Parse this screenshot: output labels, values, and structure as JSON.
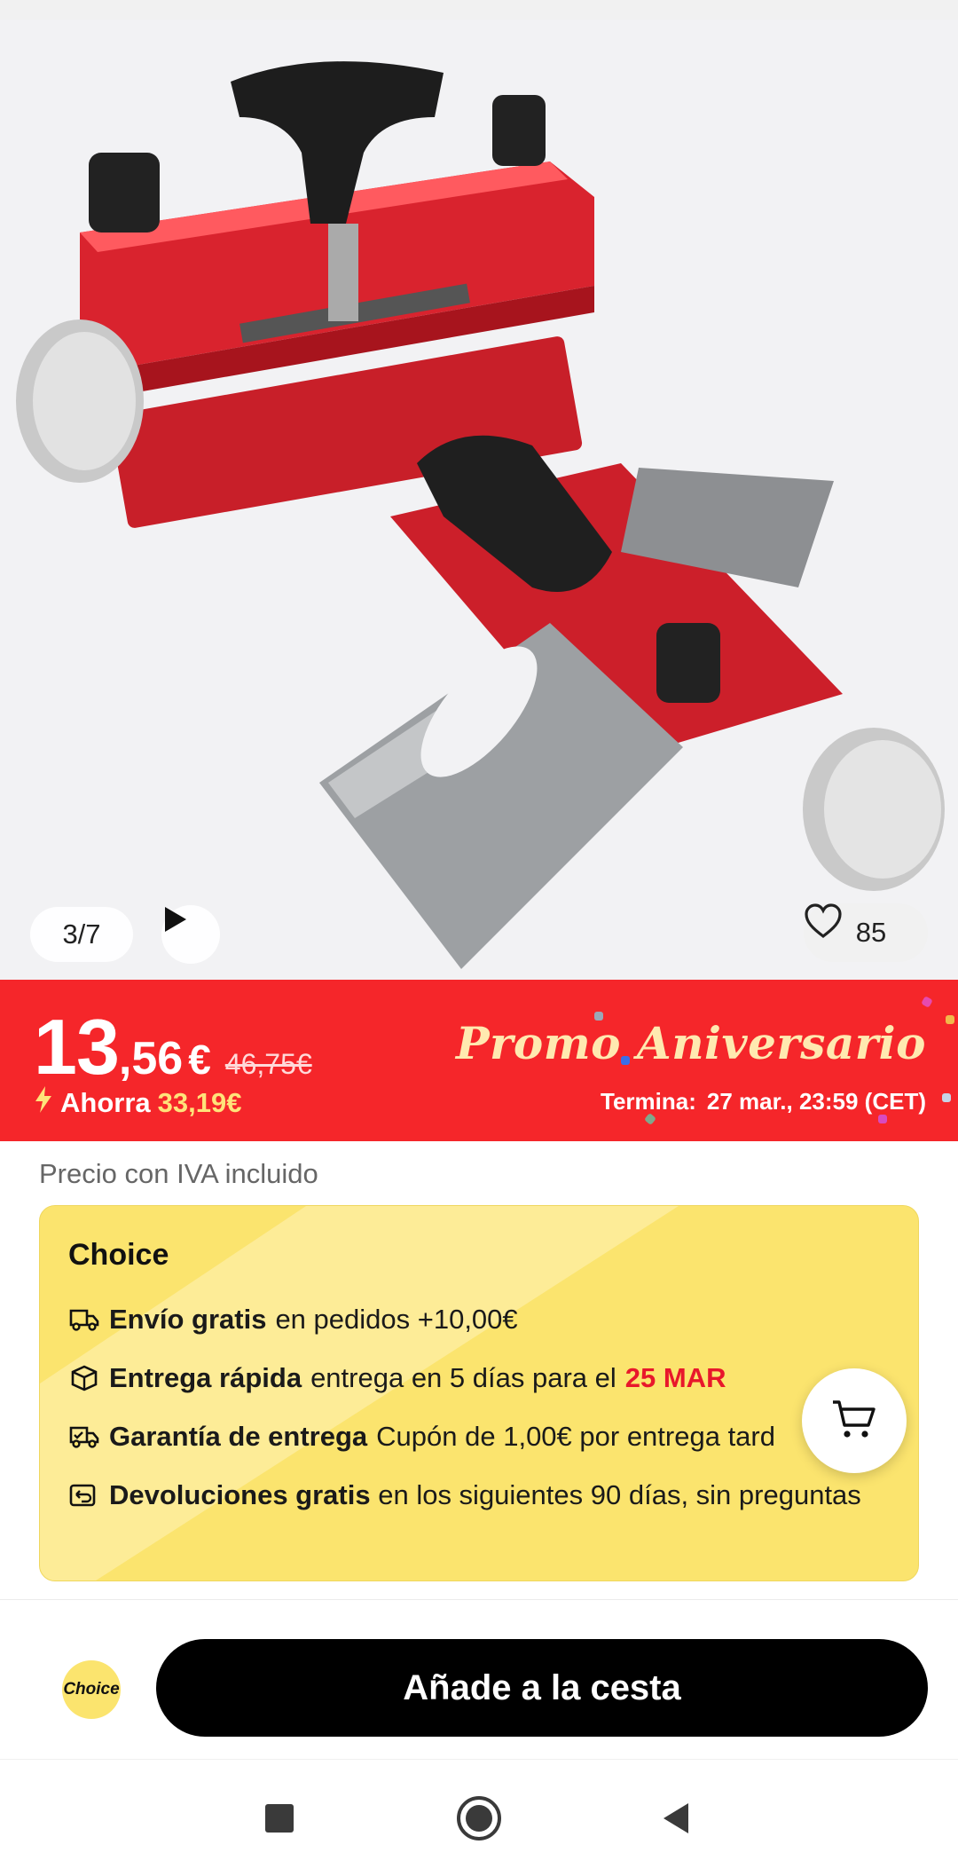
{
  "gallery": {
    "counter": "3/7",
    "wishlist_count": "85"
  },
  "promo": {
    "price_int": "13",
    "price_dec": ",56",
    "currency": "€",
    "old_price": "46,75€",
    "save_label": "Ahorra",
    "save_amount": "33,19€",
    "title": "Promo Aniversario",
    "ends_label": "Termina:",
    "ends_value": "27 mar., 23:59 (CET)"
  },
  "vat_note": "Precio con IVA incluido",
  "choice": {
    "title": "Choice",
    "benefits": [
      {
        "bold": "Envío gratis",
        "text": "en pedidos +10,00€",
        "highlight": ""
      },
      {
        "bold": "Entrega rápida",
        "text": "entrega en 5 días para el",
        "highlight": "25 MAR"
      },
      {
        "bold": "Garantía de entrega",
        "text": "Cupón de 1,00€ por entrega tard",
        "highlight": ""
      },
      {
        "bold": "Devoluciones gratis",
        "text": "en los siguientes 90 días, sin preguntas",
        "highlight": ""
      }
    ]
  },
  "action_bar": {
    "logo_text": "Choice",
    "add_to_cart": "Añade a la cesta"
  },
  "colors": {
    "promo_red": "#f5262a",
    "choice_yellow": "#fbe46e",
    "highlight_red": "#e8172b",
    "cta_black": "#000000"
  },
  "icons": [
    "play-icon",
    "heart-icon",
    "bolt-icon",
    "truck-icon",
    "box-icon",
    "delivery-guarantee-icon",
    "return-icon",
    "cart-icon",
    "nav-recents-icon",
    "nav-home-icon",
    "nav-back-icon"
  ]
}
